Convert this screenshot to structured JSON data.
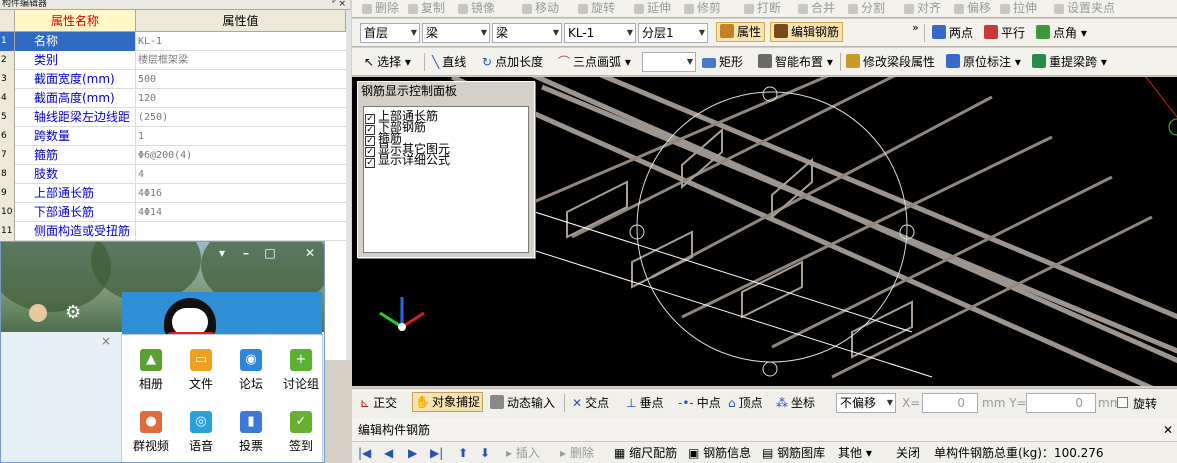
{
  "panel_title": "构件编辑器",
  "pin_glyphs": "ᴾ ×",
  "grid": {
    "col_name": "属性名称",
    "col_value": "属性值",
    "rows": [
      {
        "n": "1",
        "name": "名称",
        "value": "KL-1"
      },
      {
        "n": "2",
        "name": "类别",
        "value": "楼层框架梁"
      },
      {
        "n": "3",
        "name": "截面宽度(mm)",
        "value": "500"
      },
      {
        "n": "4",
        "name": "截面高度(mm)",
        "value": "120"
      },
      {
        "n": "5",
        "name": "轴线距梁左边线距",
        "value": "(250)"
      },
      {
        "n": "6",
        "name": "跨数量",
        "value": "1"
      },
      {
        "n": "7",
        "name": "箍筋",
        "value": "Φ6@200(4)"
      },
      {
        "n": "8",
        "name": "肢数",
        "value": "4"
      },
      {
        "n": "9",
        "name": "上部通长筋",
        "value": "4Φ16"
      },
      {
        "n": "10",
        "name": "下部通长筋",
        "value": "4Φ14"
      },
      {
        "n": "11",
        "name": "侧面构造或受扭筋",
        "value": ""
      }
    ]
  },
  "qq": {
    "apps": [
      {
        "label": "相册",
        "color": "#5aa033",
        "glyph": "▲"
      },
      {
        "label": "文件",
        "color": "#f0a020",
        "glyph": "▭"
      },
      {
        "label": "论坛",
        "color": "#2d86d8",
        "glyph": "◉"
      },
      {
        "label": "讨论组",
        "color": "#5ab030",
        "glyph": "+"
      },
      {
        "label": "群视频",
        "color": "#e06a3a",
        "glyph": "●"
      },
      {
        "label": "语音",
        "color": "#2aa0d8",
        "glyph": "◎"
      },
      {
        "label": "投票",
        "color": "#3a7ad8",
        "glyph": "▮"
      },
      {
        "label": "签到",
        "color": "#6ab030",
        "glyph": "✓"
      }
    ]
  },
  "toolbar1": [
    "删除",
    "复制",
    "镜像",
    "移动",
    "旋转",
    "延伸",
    "修剪",
    "打断",
    "合并",
    "分割",
    "对齐",
    "偏移",
    "拉伸",
    "设置夹点"
  ],
  "toolbar2": {
    "floor": "首层",
    "type": "梁",
    "subtype": "梁",
    "member": "KL-1",
    "layer": "分层1",
    "attr_btn": "属性",
    "edit_rebar_btn": "编辑钢筋",
    "two_point": "两点",
    "parallel": "平行",
    "point_angle": "点角"
  },
  "toolbar3": {
    "select": "选择",
    "line": "直线",
    "point_len": "点加长度",
    "arc": "三点画弧",
    "rect": "矩形",
    "smart": "智能布置",
    "modify_seg": "修改梁段属性",
    "orig_mark": "原位标注",
    "relift": "重提梁跨"
  },
  "control_panel": {
    "title": "钢筋显示控制面板",
    "items": [
      "上部通长筋",
      "下部钢筋",
      "箍筋",
      "显示其它图元",
      "显示详细公式"
    ]
  },
  "status": {
    "ortho": "正交",
    "snap": "对象捕捉",
    "dyn": "动态输入",
    "intersect": "交点",
    "perp": "垂点",
    "mid": "中点",
    "vertex": "顶点",
    "coord": "坐标",
    "offset_mode": "不偏移",
    "x_label": "X=",
    "x_val": "0",
    "y_label": "mm Y=",
    "y_val": "0",
    "mm": "mm",
    "rotate": "旋转"
  },
  "edit": {
    "title": "编辑构件钢筋",
    "insert": "插入",
    "delete": "删除",
    "scale": "缩尺配筋",
    "info": "钢筋信息",
    "lib": "钢筋图库",
    "other": "其他",
    "close": "关闭",
    "total": "单构件钢筋总重(kg)：100.276"
  }
}
